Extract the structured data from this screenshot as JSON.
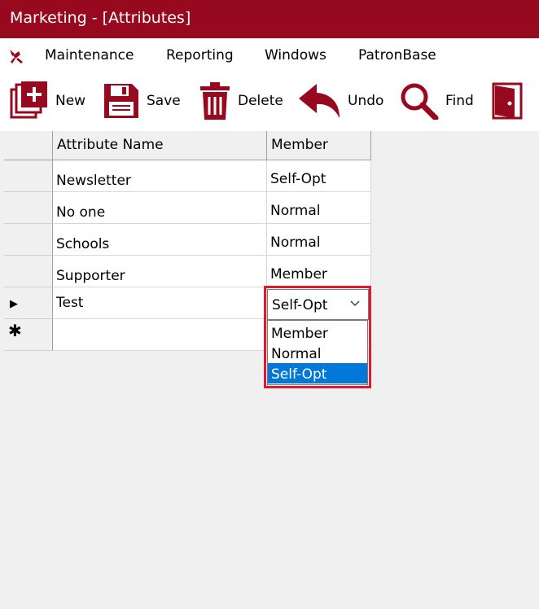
{
  "window": {
    "title": "Marketing - [Attributes]"
  },
  "menu": [
    "Maintenance",
    "Reporting",
    "Windows",
    "PatronBase"
  ],
  "toolbar": {
    "new_label": "New",
    "save_label": "Save",
    "delete_label": "Delete",
    "undo_label": "Undo",
    "find_label": "Find"
  },
  "grid": {
    "columns": [
      "Attribute Name",
      "Member"
    ],
    "rows": [
      {
        "name": "Newsletter",
        "member": "Self-Opt"
      },
      {
        "name": "No one",
        "member": "Normal"
      },
      {
        "name": "Schools",
        "member": "Normal"
      },
      {
        "name": "Supporter",
        "member": "Member"
      },
      {
        "name": "Test",
        "member": "Self-Opt"
      }
    ],
    "current_row_marker": "▶",
    "new_row_marker": "✱"
  },
  "dropdown": {
    "options": [
      "Member",
      "Normal",
      "Self-Opt"
    ],
    "selected": "Self-Opt"
  },
  "colors": {
    "titlebar": "#96091e",
    "icon": "#96091e",
    "selection": "#0078d7",
    "highlight_box": "#e0192f"
  }
}
